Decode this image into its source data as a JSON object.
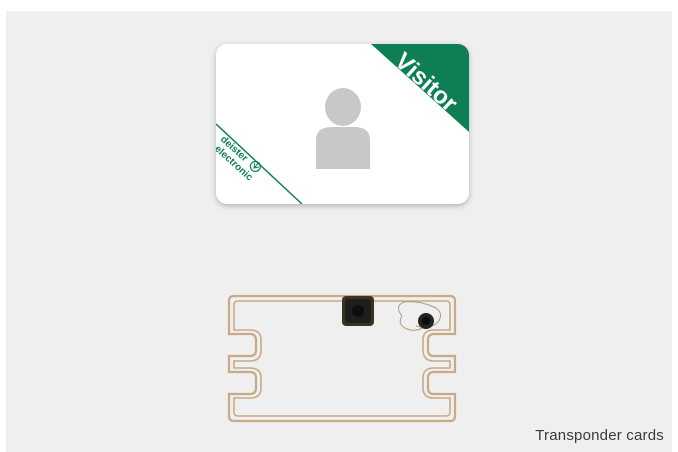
{
  "card": {
    "banner_label": "Visitor",
    "brand_line1": "deister",
    "brand_line2": "electronic",
    "accent_color": "#0e7f55",
    "avatar_color": "#c8c8c8"
  },
  "antenna": {
    "coil_color": "#c9aa86",
    "chip_color": "#2a2a2a"
  },
  "caption": {
    "text": "Transponder cards"
  }
}
